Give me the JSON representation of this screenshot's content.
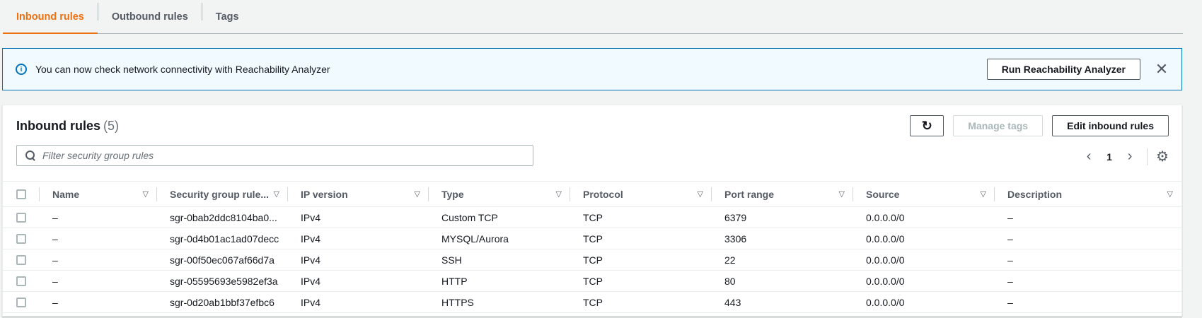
{
  "tabs": [
    {
      "label": "Inbound rules",
      "active": true
    },
    {
      "label": "Outbound rules",
      "active": false
    },
    {
      "label": "Tags",
      "active": false
    }
  ],
  "banner": {
    "text": "You can now check network connectivity with Reachability Analyzer",
    "button_label": "Run Reachability Analyzer"
  },
  "panel": {
    "title": "Inbound rules",
    "count": "(5)",
    "manage_tags_label": "Manage tags",
    "edit_label": "Edit inbound rules",
    "search_placeholder": "Filter security group rules",
    "page": "1"
  },
  "table": {
    "headers": [
      "Name",
      "Security group rule...",
      "IP version",
      "Type",
      "Protocol",
      "Port range",
      "Source",
      "Description"
    ],
    "rows": [
      [
        "–",
        "sgr-0bab2ddc8104ba0...",
        "IPv4",
        "Custom TCP",
        "TCP",
        "6379",
        "0.0.0.0/0",
        "–"
      ],
      [
        "–",
        "sgr-0d4b01ac1ad07decc",
        "IPv4",
        "MYSQL/Aurora",
        "TCP",
        "3306",
        "0.0.0.0/0",
        "–"
      ],
      [
        "–",
        "sgr-00f50ec067af66d7a",
        "IPv4",
        "SSH",
        "TCP",
        "22",
        "0.0.0.0/0",
        "–"
      ],
      [
        "–",
        "sgr-05595693e5982ef3a",
        "IPv4",
        "HTTP",
        "TCP",
        "80",
        "0.0.0.0/0",
        "–"
      ],
      [
        "–",
        "sgr-0d20ab1bbf37efbc6",
        "IPv4",
        "HTTPS",
        "TCP",
        "443",
        "0.0.0.0/0",
        "–"
      ]
    ]
  },
  "colors": {
    "accent": "#ec7211",
    "info_blue": "#0073bb"
  }
}
